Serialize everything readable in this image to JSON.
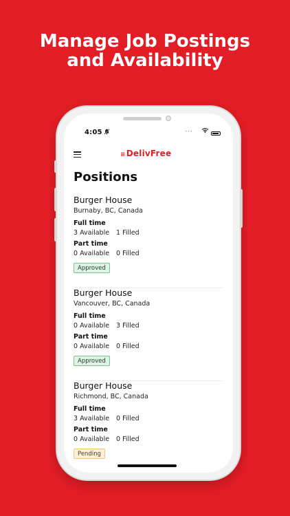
{
  "headline": {
    "line1": "Manage Job Postings",
    "line2": "and Availability"
  },
  "status_bar": {
    "time": "4:05",
    "bell_icon": "bell-slash-icon",
    "signal_dots": "⋯",
    "wifi_icon": "wifi-icon",
    "battery_icon": "battery-icon"
  },
  "app_bar": {
    "menu_icon": "hamburger-menu-icon",
    "logo_text": "DelivFree"
  },
  "page": {
    "title": "Positions"
  },
  "positions": [
    {
      "name": "Burger House",
      "location": "Burnaby, BC, Canada",
      "full_time": {
        "label": "Full time",
        "available": "3 Available",
        "filled": "1 Filled"
      },
      "part_time": {
        "label": "Part time",
        "available": "0 Available",
        "filled": "0 Filled"
      },
      "status": "Approved"
    },
    {
      "name": "Burger House",
      "location": "Vancouver, BC, Canada",
      "full_time": {
        "label": "Full time",
        "available": "0 Available",
        "filled": "3 Filled"
      },
      "part_time": {
        "label": "Part time",
        "available": "0 Available",
        "filled": "0 Filled"
      },
      "status": "Approved"
    },
    {
      "name": "Burger House",
      "location": "Richmond, BC, Canada",
      "full_time": {
        "label": "Full time",
        "available": "3 Available",
        "filled": "0 Filled"
      },
      "part_time": {
        "label": "Part time",
        "available": "0 Available",
        "filled": "0 Filled"
      },
      "status": "Pending"
    }
  ],
  "colors": {
    "brand_red": "#e31d25",
    "approved_bg": "#dff3e4",
    "pending_bg": "#fdf0da"
  }
}
